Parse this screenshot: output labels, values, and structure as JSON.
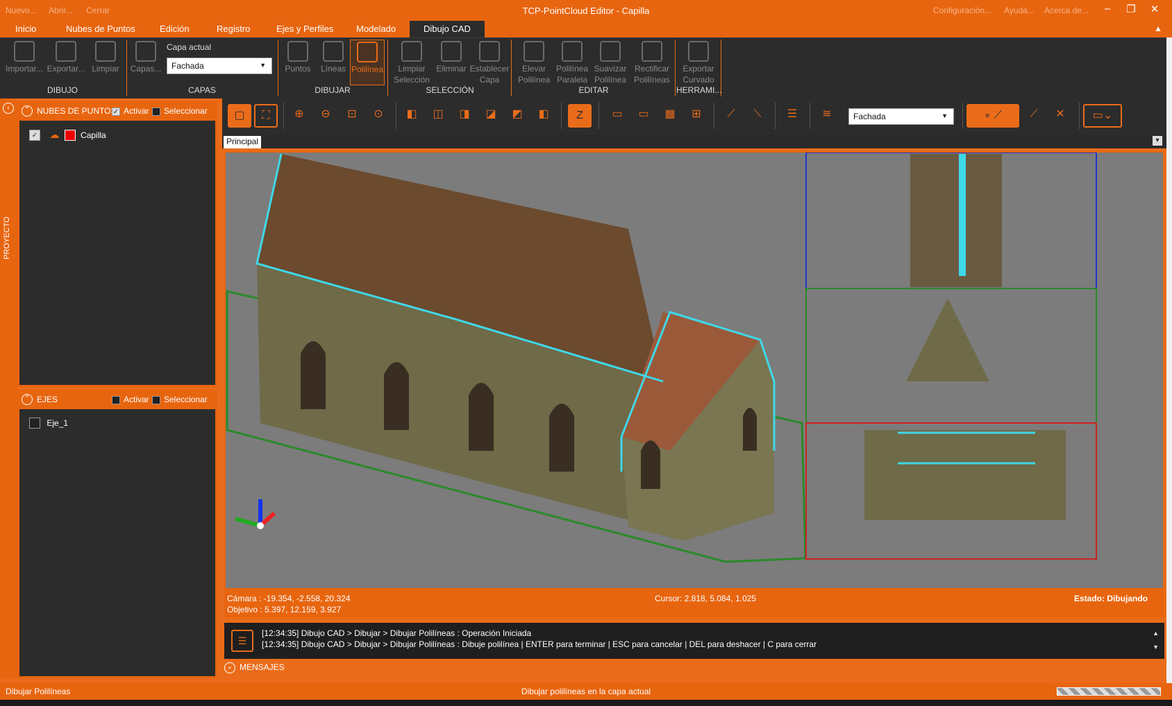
{
  "titlebar": {
    "quick_access": [
      "Nuevo...",
      "Abrir...",
      "Cerrar"
    ],
    "title": "TCP-PointCloud Editor - Capilla",
    "right_links": [
      "Configuración...",
      "Ayuda...",
      "Acerca de..."
    ]
  },
  "menu": {
    "tabs": [
      "Inicio",
      "Nubes de Puntos",
      "Edición",
      "Registro",
      "Ejes y Perfiles",
      "Modelado",
      "Dibujo CAD"
    ],
    "active": "Dibujo CAD"
  },
  "ribbon": {
    "dibujo": {
      "importar": "Importar...",
      "exportar": "Exportar...",
      "limpiar": "Limpiar",
      "group": "DIBUJO"
    },
    "capas": {
      "capas": "Capas...",
      "capa_actual_label": "Capa actual",
      "capa_actual_value": "Fachada",
      "group": "CAPAS"
    },
    "dibujar": {
      "puntos": "Puntos",
      "lineas": "Líneas",
      "polilinea": "Polilínea",
      "group": "DIBUJAR"
    },
    "seleccion": {
      "limpiar1": "Limpiar",
      "limpiar2": "Selección",
      "eliminar": "Eliminar",
      "establecer1": "Establecer",
      "establecer2": "Capa",
      "group": "SELECCIÓN"
    },
    "editar": {
      "elevar1": "Elevar",
      "elevar2": "Polilínea",
      "paralela1": "Polilínea",
      "paralela2": "Paralela",
      "suavizar1": "Suavizar",
      "suavizar2": "Polilínea",
      "rectificar1": "Rectificar",
      "rectificar2": "Polilíneas",
      "group": "EDITAR"
    },
    "herramientas": {
      "exportar1": "Exportar",
      "exportar2": "Curvado",
      "group": "HERRAMI..."
    }
  },
  "left_panel": {
    "proyecto": "PROYECTO",
    "nubes": {
      "title": "NUBES DE PUNTOS",
      "activar": "Activar",
      "seleccionar": "Seleccionar",
      "items": [
        "Capilla"
      ]
    },
    "ejes": {
      "title": "EJES",
      "activar": "Activar",
      "seleccionar": "Seleccionar",
      "items": [
        "Eje_1"
      ]
    }
  },
  "toolbar": {
    "layer_value": "Fachada"
  },
  "view": {
    "tab": "Principal"
  },
  "status": {
    "camara": "Cámara : -19.354, -2.558, 20.324",
    "objetivo": "Objetivo : 5.397, 12.159, 3.927",
    "cursor": "Cursor: 2.818, 5.084, 1.025",
    "estado": "Estado: Dibujando"
  },
  "messages": {
    "lines": [
      "[12:34:35] Dibujo CAD > Dibujar > Dibujar Polilíneas : Operación Iniciada",
      "[12:34:35] Dibujo CAD > Dibujar > Dibujar Polilíneas : Dibuje polilínea | ENTER para terminar | ESC para cancelar | DEL para deshacer | C para cerrar"
    ],
    "header": "MENSAJES"
  },
  "bottom": {
    "left": "Dibujar Polilíneas",
    "center": "Dibujar polilíneas en la capa actual"
  },
  "colors": {
    "accent": "#e8650f",
    "panel": "#2c2c2c",
    "viewport": "#7a7a7a",
    "cyan": "#3fd8e8"
  }
}
